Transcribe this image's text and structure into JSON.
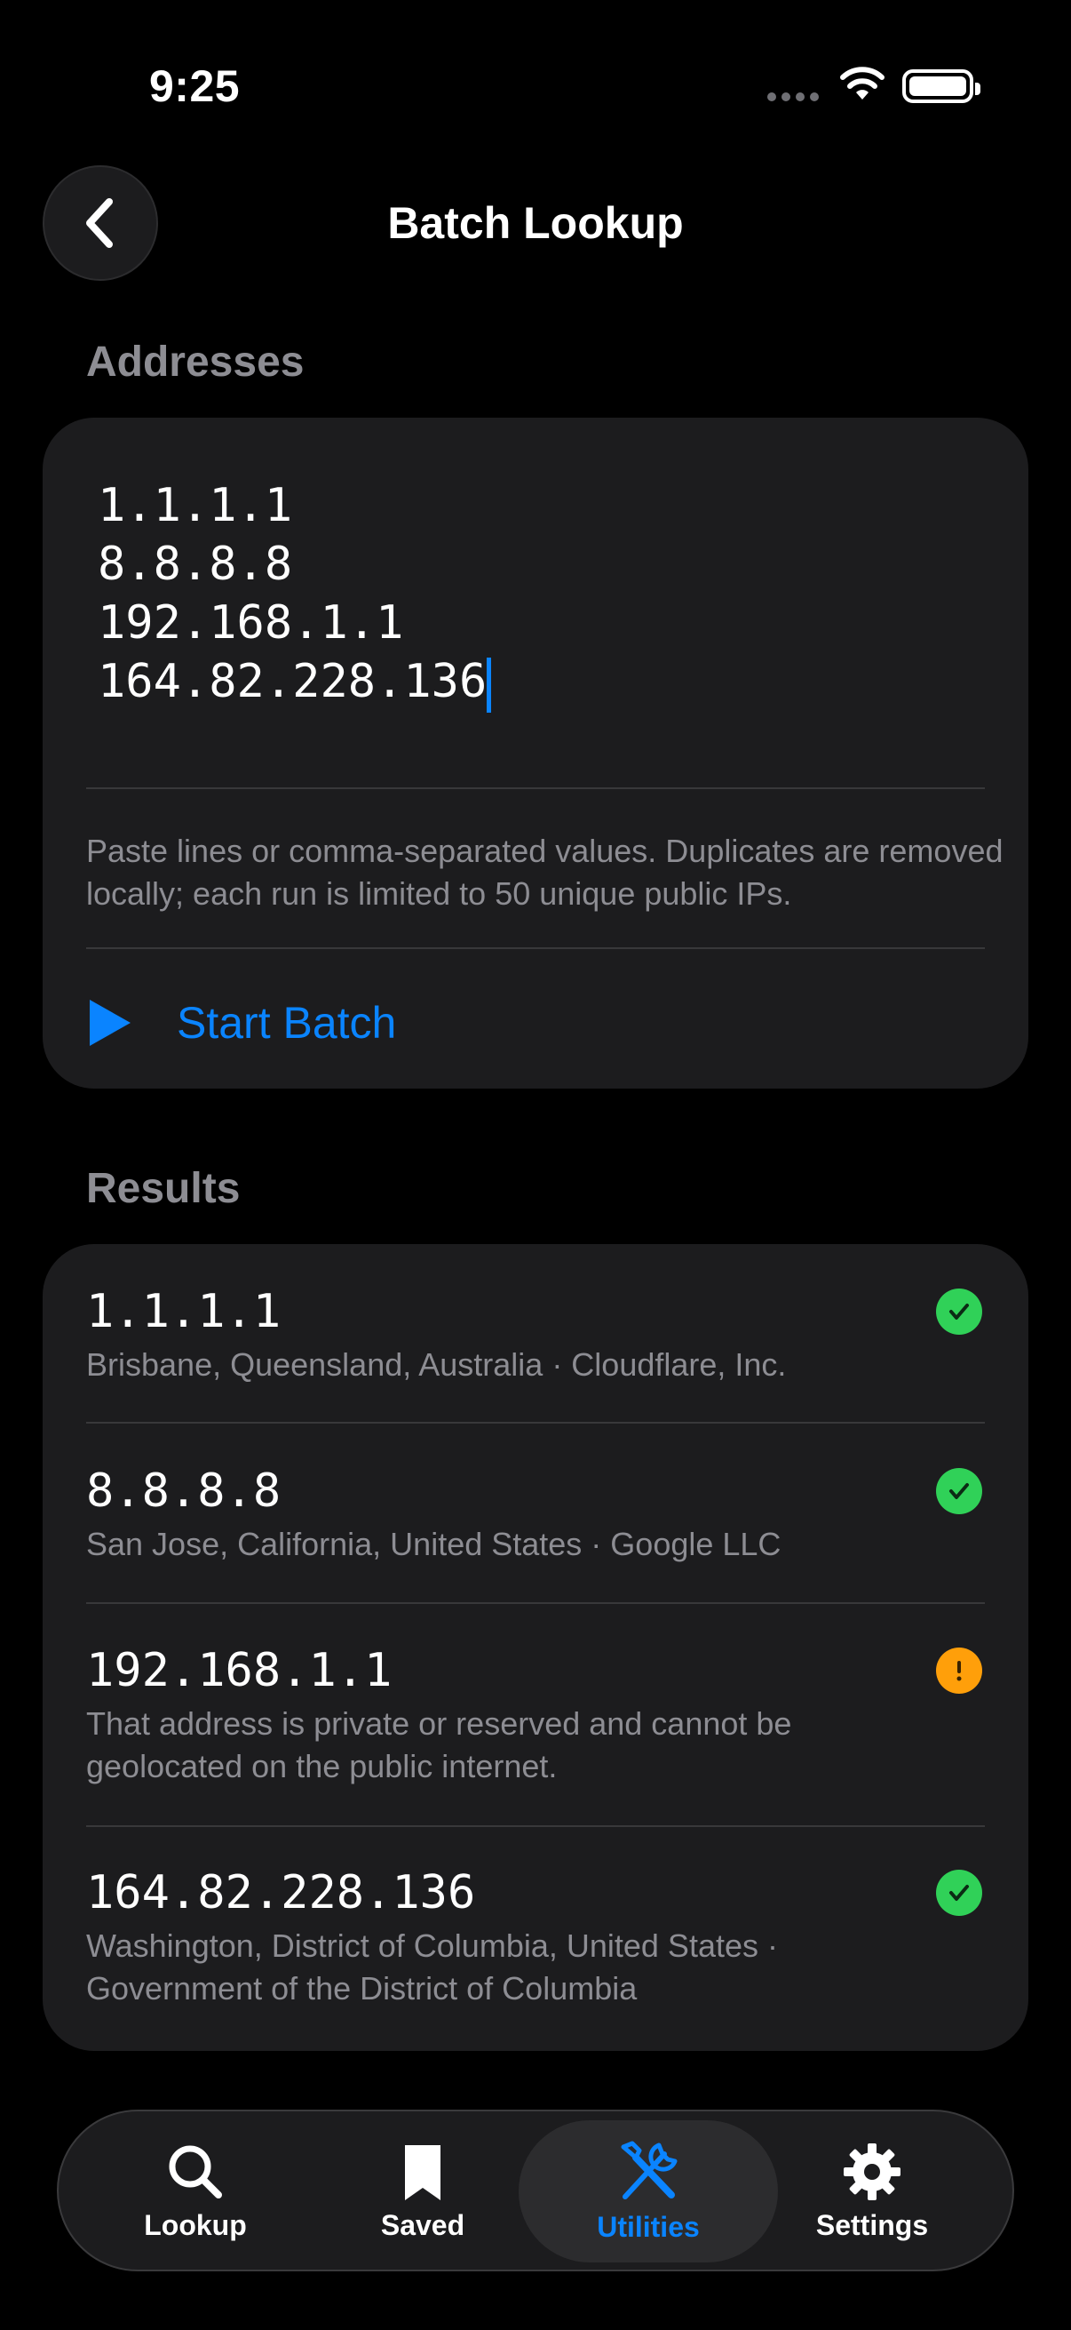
{
  "status_bar": {
    "time": "9:25"
  },
  "nav": {
    "title": "Batch Lookup",
    "back_icon": "chevron-left-icon"
  },
  "addresses": {
    "section_label": "Addresses",
    "input_value": "1.1.1.1\n8.8.8.8\n192.168.1.1\n164.82.228.136",
    "hint": "Paste lines or comma-separated values. Duplicates are removed locally; each run is limited to 50 unique public IPs.",
    "start_label": "Start Batch"
  },
  "results": {
    "section_label": "Results",
    "items": [
      {
        "ip": "1.1.1.1",
        "detail": "Brisbane, Queensland, Australia · Cloudflare, Inc.",
        "status": "success"
      },
      {
        "ip": "8.8.8.8",
        "detail": "San Jose, California, United States · Google LLC",
        "status": "success"
      },
      {
        "ip": "192.168.1.1",
        "detail": "That address is private or reserved and cannot be geolocated on the public internet.",
        "status": "warning"
      },
      {
        "ip": "164.82.228.136",
        "detail": "Washington, District of Columbia, United States · Government of the District of Columbia",
        "status": "success"
      }
    ]
  },
  "tabs": [
    {
      "label": "Lookup",
      "icon": "magnifier-icon",
      "active": false
    },
    {
      "label": "Saved",
      "icon": "bookmark-icon",
      "active": false
    },
    {
      "label": "Utilities",
      "icon": "tools-icon",
      "active": true
    },
    {
      "label": "Settings",
      "icon": "gear-icon",
      "active": false
    }
  ],
  "colors": {
    "accent": "#0a84ff",
    "success": "#30d158",
    "warning": "#ff9f0a",
    "card": "#1c1c1e",
    "secondary_text": "#8d8d93"
  }
}
